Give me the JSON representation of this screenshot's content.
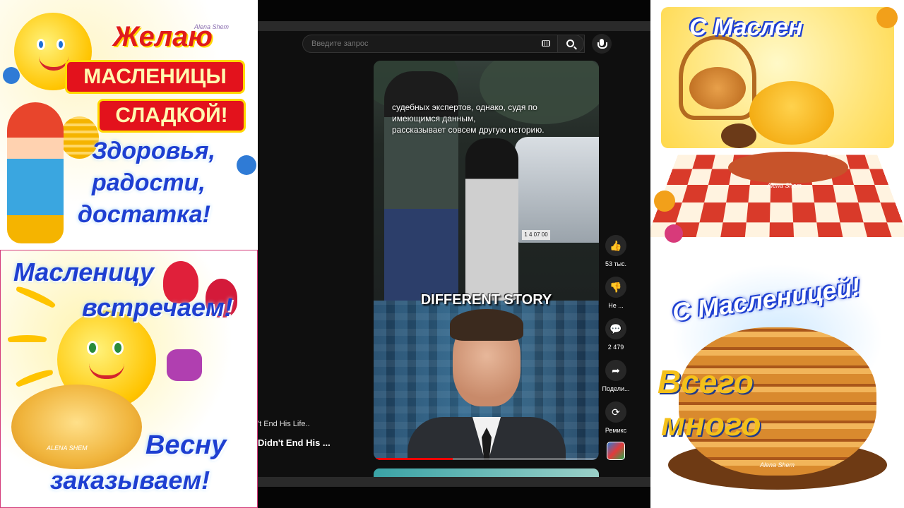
{
  "postcards": {
    "top_left": {
      "line1": "Желаю",
      "line2": "МАСЛЕНИЦЫ",
      "line3": "СЛАДКОЙ!",
      "line4": "Здоровья,",
      "line5": "радости,",
      "line6": "достатка!",
      "signature": "Alena Shem"
    },
    "bottom_left": {
      "line1": "Масленицу",
      "line2": "встречаем!",
      "line3": "Весну",
      "line4": "заказываем!",
      "signature": "ALENA SHEM"
    },
    "top_right": {
      "line1": "С Маслен",
      "signature": "Alena Shem"
    },
    "bottom_right": {
      "line1": "С Масленицей!",
      "line2": "Всего",
      "line3": "много",
      "signature": "Alena Shem"
    }
  },
  "app": {
    "search": {
      "placeholder": "Введите запрос"
    },
    "video": {
      "caption_lines": [
        "судебных экспертов, однако, судя по",
        "имеющимся данным,",
        "рассказывает совсем другую историю."
      ],
      "plate_text": "1 4 07 00",
      "headline": "DIFFERENT STORY",
      "progress": 0.35
    },
    "left_titles": {
      "line1": "'t End His Life..",
      "line2": "Didn't End His ..."
    },
    "actions": [
      {
        "icon": "thumbs-up-icon",
        "glyph": "👍",
        "label": "53 тыс."
      },
      {
        "icon": "thumbs-down-icon",
        "glyph": "👎",
        "label": "Не ..."
      },
      {
        "icon": "comment-icon",
        "glyph": "💬",
        "label": "2 479"
      },
      {
        "icon": "share-icon",
        "glyph": "➦",
        "label": "Подели..."
      },
      {
        "icon": "remix-icon",
        "glyph": "⟳",
        "label": "Ремикс"
      }
    ]
  }
}
